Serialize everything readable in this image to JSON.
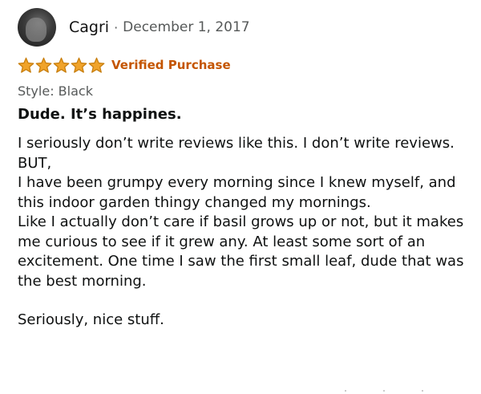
{
  "reviewer": {
    "name": "Cagri",
    "separator": "·",
    "date": "December 1, 2017",
    "avatar_icon": "reviewer-avatar"
  },
  "rating": {
    "stars": 5,
    "max": 5,
    "star_color": "#f0a32a",
    "star_stroke": "#c77d0c",
    "verified_label": "Verified Purchase",
    "verified_color": "#c45500"
  },
  "style_line": "Style: Black",
  "title": "Dude. It’s happines.",
  "body": {
    "p1": "I seriously don’t write reviews like this. I don’t write reviews. BUT,",
    "p2": "I have been grumpy every morning since I knew myself, and this indoor garden thingy changed my mornings.",
    "p3": "Like I actually don’t care if basil grows up or not, but it makes me curious to see if it grew any. At least some sort of an excitement. One time I saw the first small leaf, dude that was the best morning.",
    "p4": "Seriously, nice stuff."
  }
}
